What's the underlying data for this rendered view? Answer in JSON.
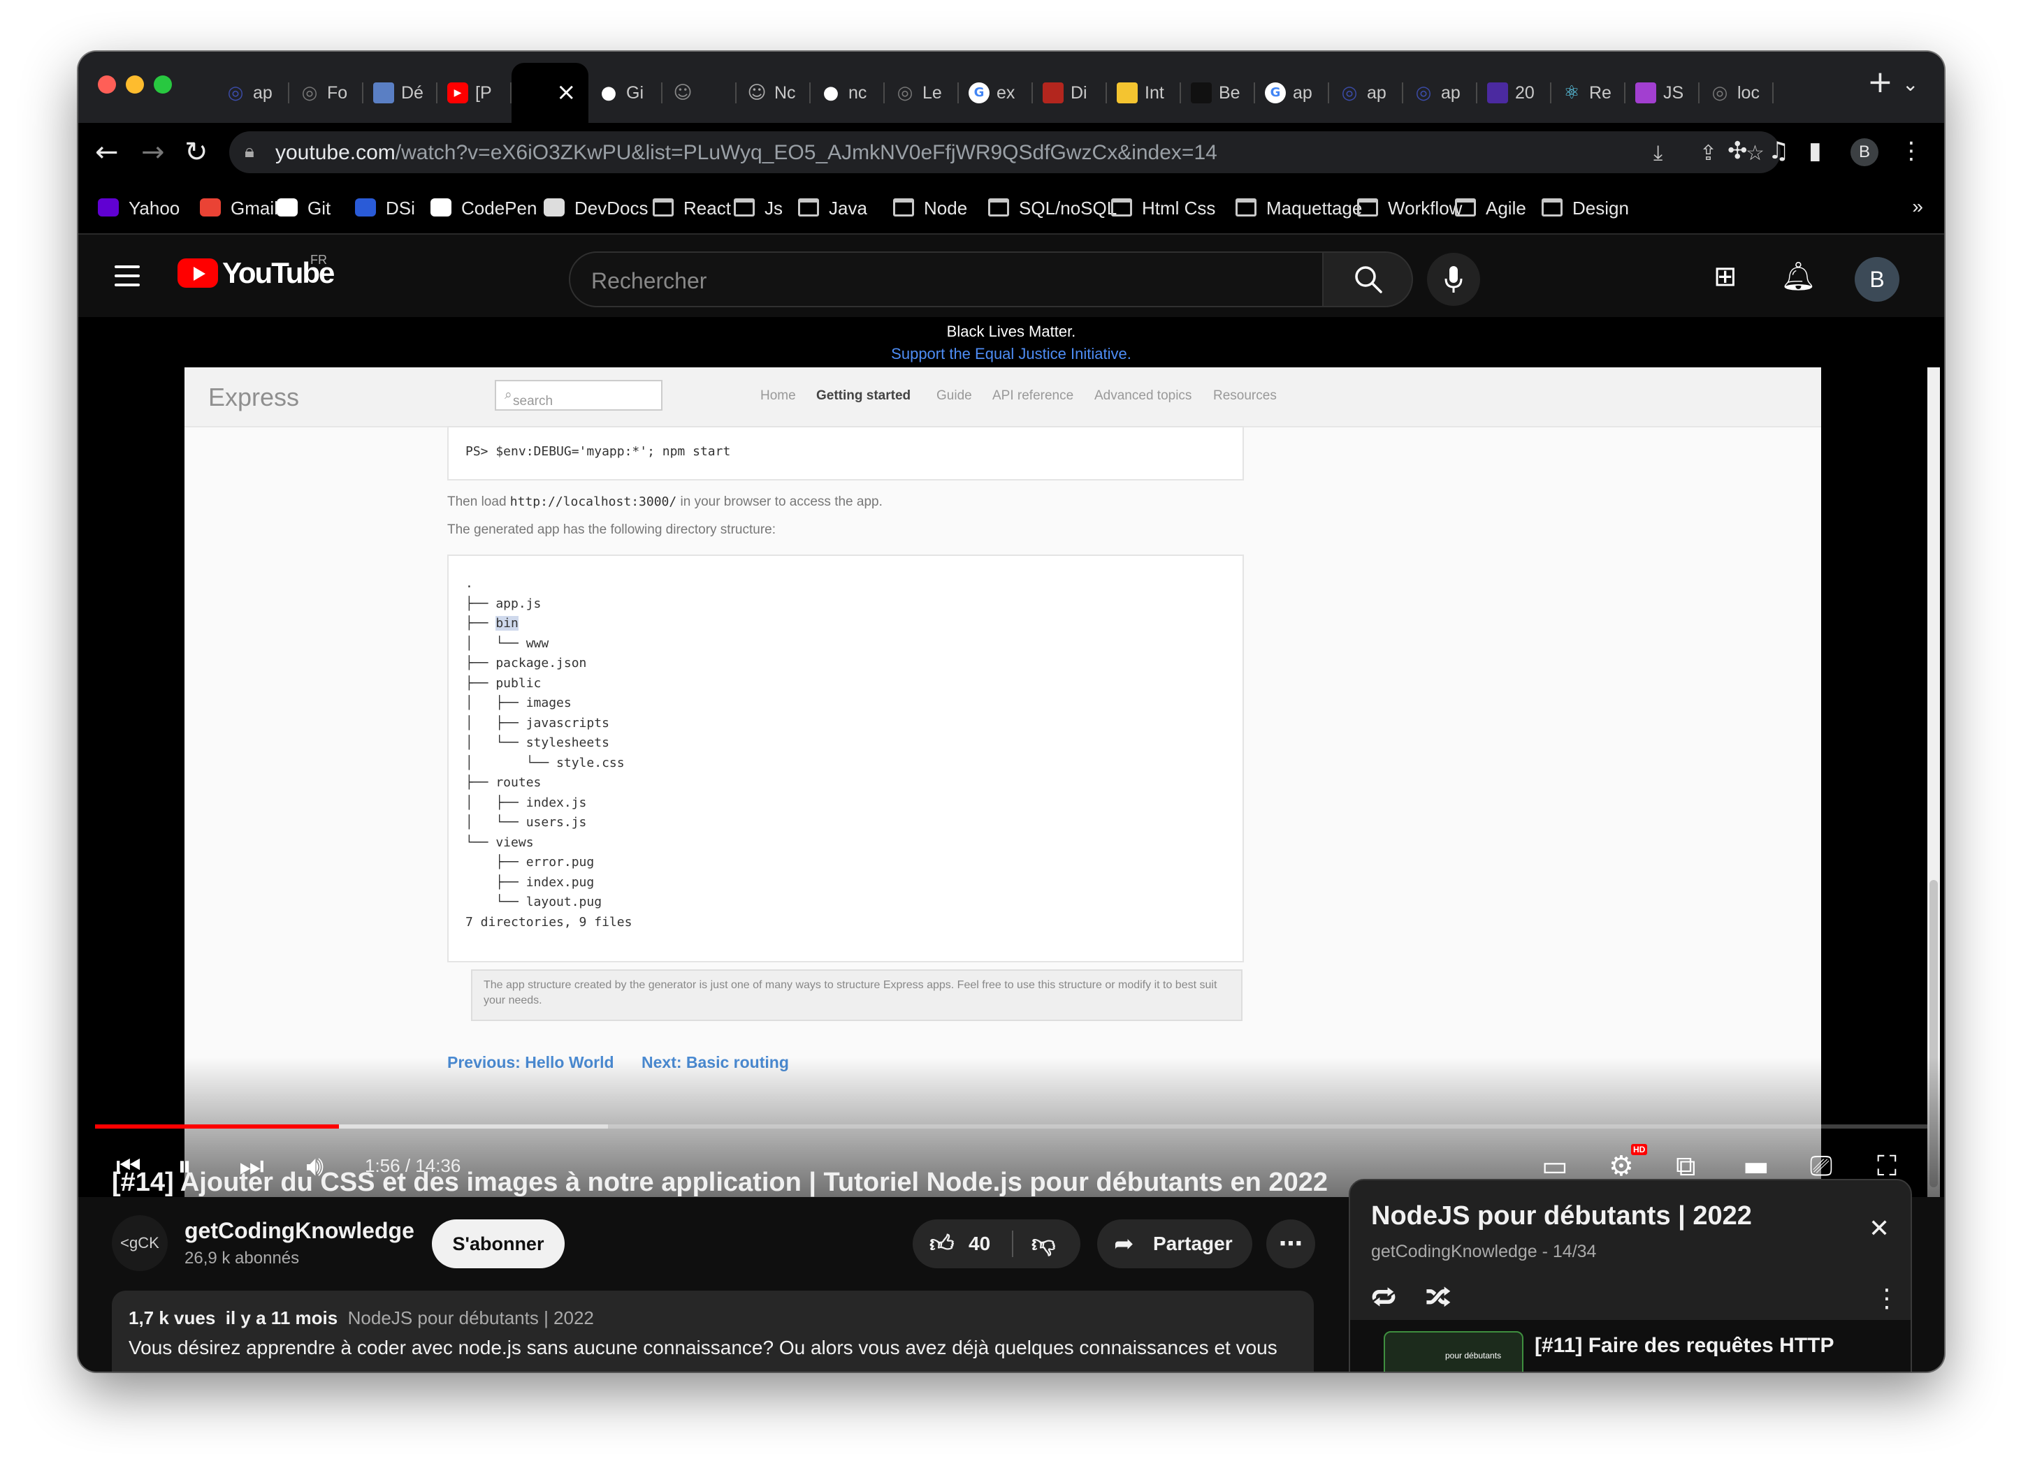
{
  "browser": {
    "tabs": [
      {
        "label": "ap",
        "icon": "globe-icon",
        "color": "#3b4ba6"
      },
      {
        "label": "Fo",
        "icon": "globe-icon",
        "color": "#777777"
      },
      {
        "label": "Dé",
        "icon": "site-icon",
        "color": "#5a7fc4"
      },
      {
        "label": "[P",
        "icon": "youtube-icon",
        "color": "#ff0000"
      },
      {
        "label": "",
        "icon": "speaker-icon",
        "color": "#000000",
        "active": true
      },
      {
        "label": "Gi",
        "icon": "github-icon",
        "color": "#ffffff"
      },
      {
        "label": "",
        "icon": "avatar-icon",
        "color": "#888888"
      },
      {
        "label": "Nc",
        "icon": "avatar-icon",
        "color": "#aaaaaa"
      },
      {
        "label": "nc",
        "icon": "github-icon",
        "color": "#ffffff"
      },
      {
        "label": "Le",
        "icon": "globe-icon",
        "color": "#777777"
      },
      {
        "label": "ex",
        "icon": "google-icon",
        "color": "#4285f4"
      },
      {
        "label": "Di",
        "icon": "site-icon",
        "color": "#b3261e"
      },
      {
        "label": "Int",
        "icon": "site-icon",
        "color": "#f4c430"
      },
      {
        "label": "Be",
        "icon": "site-icon",
        "color": "#111111"
      },
      {
        "label": "ap",
        "icon": "google-icon",
        "color": "#4285f4"
      },
      {
        "label": "ap",
        "icon": "globe-icon",
        "color": "#3b4ba6"
      },
      {
        "label": "ap",
        "icon": "globe-icon",
        "color": "#3b4ba6"
      },
      {
        "label": "20",
        "icon": "site-icon",
        "color": "#4b2aa0"
      },
      {
        "label": "Re",
        "icon": "react-icon",
        "color": "#61dafb"
      },
      {
        "label": "JS",
        "icon": "site-icon",
        "color": "#a23fd0"
      },
      {
        "label": "loc",
        "icon": "globe-icon",
        "color": "#777777"
      }
    ],
    "address_host": "youtube.com",
    "address_path": "/watch?v=eX6iO3ZKwPU&list=PLuWyq_EO5_AJmkNV0eFfjWR9QSdfGwzCx&index=14",
    "profile_initial": "B",
    "bookmarks": [
      {
        "label": "Yahoo",
        "icon": "yahoo-icon",
        "color": "#6001d2"
      },
      {
        "label": "Gmail",
        "icon": "gmail-icon",
        "color": "#ea4335"
      },
      {
        "label": "Git",
        "icon": "github-icon",
        "color": "#ffffff"
      },
      {
        "label": "DSi",
        "icon": "vue-icon",
        "color": "#2a5bd7"
      },
      {
        "label": "CodePen",
        "icon": "codepen-icon",
        "color": "#ffffff"
      },
      {
        "label": "DevDocs",
        "icon": "devdocs-icon",
        "color": "#dddddd"
      },
      {
        "label": "React",
        "icon": "folder-icon"
      },
      {
        "label": "Js",
        "icon": "folder-icon"
      },
      {
        "label": "Java",
        "icon": "folder-icon"
      },
      {
        "label": "Node",
        "icon": "folder-icon"
      },
      {
        "label": "SQL/noSQL",
        "icon": "folder-icon"
      },
      {
        "label": "Html Css",
        "icon": "folder-icon"
      },
      {
        "label": "Maquettage",
        "icon": "folder-icon"
      },
      {
        "label": "Workflow",
        "icon": "folder-icon"
      },
      {
        "label": "Agile",
        "icon": "folder-icon"
      },
      {
        "label": "Design",
        "icon": "folder-icon"
      }
    ],
    "bookmarks_more": "»"
  },
  "youtube": {
    "logo_text": "YouTube",
    "region": "FR",
    "search_placeholder": "Rechercher",
    "avatar_initial": "B"
  },
  "video": {
    "banner_line1": "Black Lives Matter.",
    "banner_line2": "Support the Equal Justice Initiative.",
    "express": {
      "logo": "Express",
      "search_placeholder": "search",
      "nav": [
        "Home",
        "Getting started",
        "Guide",
        "API reference",
        "Advanced topics",
        "Resources"
      ],
      "current_nav": "Getting started",
      "command": "PS> $env:DEBUG='myapp:*'; npm start",
      "load_text_before": "Then load ",
      "load_url": "http://localhost:3000/",
      "load_text_after": " in your browser to access the app.",
      "structure_intro": "The generated app has the following directory structure:",
      "tree_lines": [
        ".",
        "├── app.js",
        "├── bin",
        "│   └── www",
        "├── package.json",
        "├── public",
        "│   ├── images",
        "│   ├── javascripts",
        "│   └── stylesheets",
        "│       └── style.css",
        "├── routes",
        "│   ├── index.js",
        "│   └── users.js",
        "└── views",
        "    ├── error.pug",
        "    ├── index.pug",
        "    └── layout.pug",
        "",
        "7 directories, 9 files"
      ],
      "highlighted_word": "bin",
      "note": "The app structure created by the generator is just one of many ways to structure Express apps. Feel free to use this structure or modify it to best suit your needs.",
      "previous_link": "Previous: Hello World",
      "next_link": "Next: Basic routing"
    },
    "time_current": "1:56",
    "time_total": "14:36",
    "time_display": "1:56 / 14:36",
    "progress_played_fraction": 0.133,
    "progress_loaded_fraction": 0.28,
    "hd_badge": "HD",
    "title": "[#14] Ajouter du CSS et des images à notre application | Tutoriel Node.js pour débutants en 2022",
    "channel_avatar_text": "<gCK />",
    "channel_name": "getCodingKnowledge",
    "subscribers": "26,9 k abonnés",
    "subscribe_label": "S'abonner",
    "likes": "40",
    "share_label": "Partager",
    "views": "1,7 k vues",
    "age": "il y a 11 mois",
    "playlist_tag": "NodeJS pour débutants | 2022",
    "description_line": "Vous désirez apprendre à coder avec node.js sans aucune connaissance? Ou alors vous avez déjà quelques connaissances et vous"
  },
  "playlist": {
    "title": "NodeJS pour débutants | 2022",
    "subtitle": "getCodingKnowledge - 14/34",
    "next_item_title": "[#11] Faire des requêtes HTTP",
    "next_item_thumb_text": "pour débutants"
  }
}
